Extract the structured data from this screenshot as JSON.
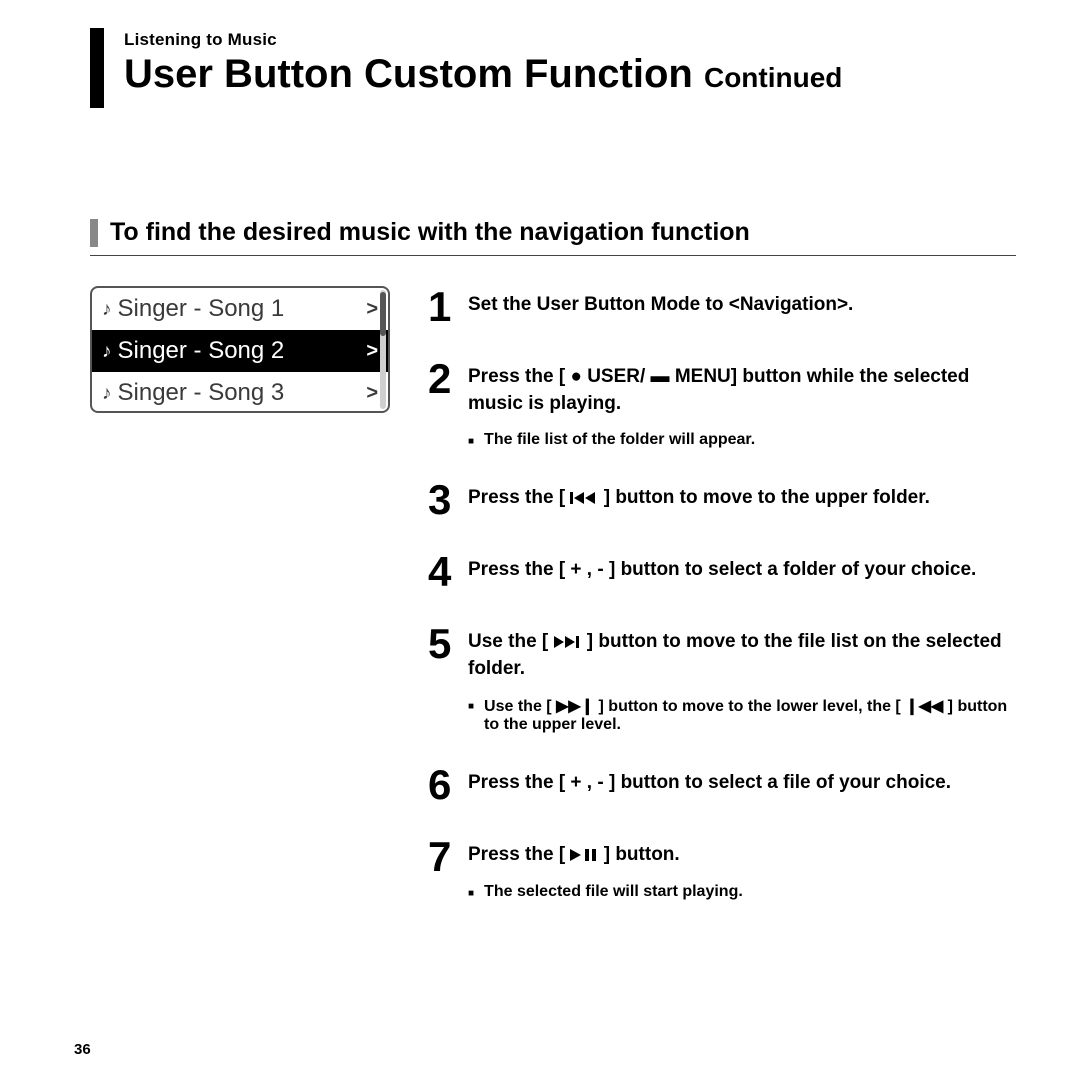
{
  "header": {
    "breadcrumb": "Listening to Music",
    "title_main": "User Button Custom Function",
    "title_suffix": "Continued"
  },
  "section": {
    "heading": "To find the desired music with the navigation function"
  },
  "device_screen": {
    "rows": [
      {
        "label": "Singer - Song 1",
        "selected": false
      },
      {
        "label": "Singer - Song 2",
        "selected": true
      },
      {
        "label": "Singer - Song 3",
        "selected": false
      }
    ]
  },
  "steps": [
    {
      "num": "1",
      "body_parts": [
        "Set the User Button Mode to <Navigation>."
      ],
      "notes": []
    },
    {
      "num": "2",
      "body_parts": [
        "Press the [ ",
        "●",
        " USER/ ",
        "▬",
        " MENU] button while the selected music is playing."
      ],
      "notes": [
        "The file list of the folder will appear."
      ]
    },
    {
      "num": "3",
      "body_parts": [
        "Press the [ ",
        "prev",
        " ] button to move to the upper folder."
      ],
      "notes": []
    },
    {
      "num": "4",
      "body_parts": [
        "Press the [ + , - ] button to select a folder of your choice."
      ],
      "notes": []
    },
    {
      "num": "5",
      "body_parts": [
        "Use the [ ",
        "next",
        " ] button to move to the file list on the selected folder."
      ],
      "notes": [
        "Use the [ ▶▶❙ ] button to move to the lower level, the [ ❙◀◀ ] button to the upper level."
      ]
    },
    {
      "num": "6",
      "body_parts": [
        "Press the [ + , - ] button to select a file of your choice."
      ],
      "notes": []
    },
    {
      "num": "7",
      "body_parts": [
        "Press the [ ",
        "playpause",
        " ] button."
      ],
      "notes": [
        "The selected file will start playing."
      ]
    }
  ],
  "page_number": "36"
}
